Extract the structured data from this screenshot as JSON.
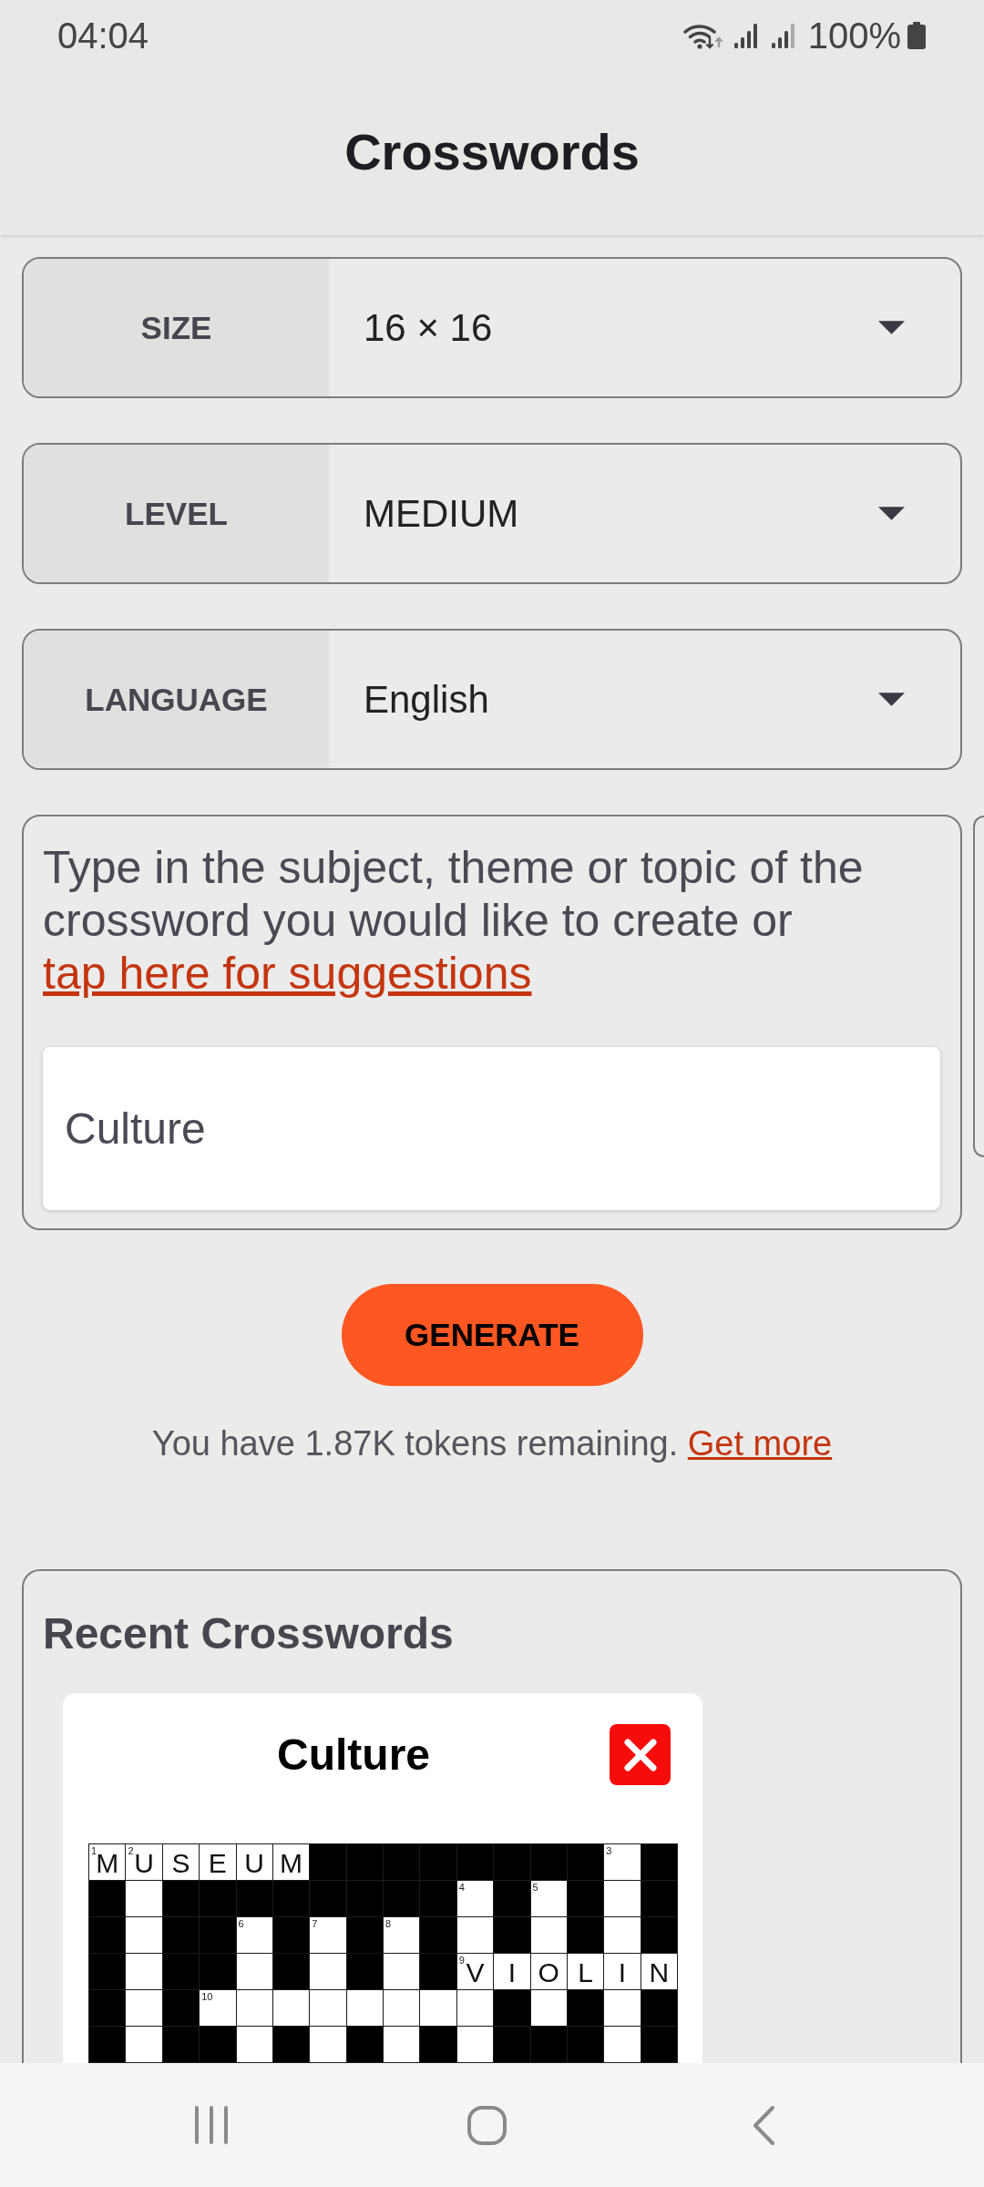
{
  "status_bar": {
    "time": "04:04",
    "battery": "100%"
  },
  "app_bar": {
    "title": "Crosswords"
  },
  "selects": [
    {
      "label": "SIZE",
      "value": "16 × 16"
    },
    {
      "label": "LEVEL",
      "value": "MEDIUM"
    },
    {
      "label": "LANGUAGE",
      "value": "English"
    }
  ],
  "topic_panel": {
    "instructions": "Type in the subject, theme or topic of the crossword you would like to create or ",
    "link": "tap here for suggestions"
  },
  "topic_field": {
    "value": "Culture"
  },
  "generate_button": {
    "label": "GENERATE"
  },
  "tokens": {
    "text": "You have 1.87K tokens remaining. ",
    "link": "Get more"
  },
  "recent": {
    "title": "Recent Crosswords",
    "crosswords": [
      {
        "title": "Culture",
        "grid": [
          [
            {
              "kind": "open",
              "number": "1",
              "letter": "M"
            },
            {
              "kind": "open",
              "number": "2",
              "letter": "U"
            },
            {
              "kind": "open",
              "letter": "S"
            },
            {
              "kind": "open",
              "letter": "E"
            },
            {
              "kind": "open",
              "letter": "U"
            },
            {
              "kind": "open",
              "letter": "M"
            },
            {
              "kind": "block"
            },
            {
              "kind": "block"
            },
            {
              "kind": "block"
            },
            {
              "kind": "block"
            },
            {
              "kind": "block"
            },
            {
              "kind": "block"
            },
            {
              "kind": "block"
            },
            {
              "kind": "block"
            },
            {
              "kind": "open",
              "number": "3"
            },
            {
              "kind": "block"
            }
          ],
          [
            {
              "kind": "block"
            },
            {
              "kind": "open"
            },
            {
              "kind": "block"
            },
            {
              "kind": "block"
            },
            {
              "kind": "block"
            },
            {
              "kind": "block"
            },
            {
              "kind": "block"
            },
            {
              "kind": "block"
            },
            {
              "kind": "block"
            },
            {
              "kind": "block"
            },
            {
              "kind": "open",
              "number": "4"
            },
            {
              "kind": "block"
            },
            {
              "kind": "open",
              "number": "5"
            },
            {
              "kind": "block"
            },
            {
              "kind": "open"
            },
            {
              "kind": "block"
            }
          ],
          [
            {
              "kind": "block"
            },
            {
              "kind": "open"
            },
            {
              "kind": "block"
            },
            {
              "kind": "block"
            },
            {
              "kind": "open",
              "number": "6"
            },
            {
              "kind": "block"
            },
            {
              "kind": "open",
              "number": "7"
            },
            {
              "kind": "block"
            },
            {
              "kind": "open",
              "number": "8"
            },
            {
              "kind": "block"
            },
            {
              "kind": "open"
            },
            {
              "kind": "block"
            },
            {
              "kind": "open"
            },
            {
              "kind": "block"
            },
            {
              "kind": "open"
            },
            {
              "kind": "block"
            }
          ],
          [
            {
              "kind": "block"
            },
            {
              "kind": "open"
            },
            {
              "kind": "block"
            },
            {
              "kind": "block"
            },
            {
              "kind": "open"
            },
            {
              "kind": "block"
            },
            {
              "kind": "open"
            },
            {
              "kind": "block"
            },
            {
              "kind": "open"
            },
            {
              "kind": "block"
            },
            {
              "kind": "open",
              "number": "9",
              "letter": "V"
            },
            {
              "kind": "open",
              "letter": "I"
            },
            {
              "kind": "open",
              "letter": "O"
            },
            {
              "kind": "open",
              "letter": "L"
            },
            {
              "kind": "open",
              "letter": "I"
            },
            {
              "kind": "open",
              "letter": "N"
            }
          ],
          [
            {
              "kind": "block"
            },
            {
              "kind": "open"
            },
            {
              "kind": "block"
            },
            {
              "kind": "open",
              "number": "10"
            },
            {
              "kind": "open"
            },
            {
              "kind": "open"
            },
            {
              "kind": "open"
            },
            {
              "kind": "open"
            },
            {
              "kind": "open"
            },
            {
              "kind": "open"
            },
            {
              "kind": "open"
            },
            {
              "kind": "block"
            },
            {
              "kind": "open"
            },
            {
              "kind": "block"
            },
            {
              "kind": "open"
            },
            {
              "kind": "block"
            }
          ],
          [
            {
              "kind": "block"
            },
            {
              "kind": "open"
            },
            {
              "kind": "block"
            },
            {
              "kind": "block"
            },
            {
              "kind": "open"
            },
            {
              "kind": "block"
            },
            {
              "kind": "open"
            },
            {
              "kind": "block"
            },
            {
              "kind": "open"
            },
            {
              "kind": "block"
            },
            {
              "kind": "open"
            },
            {
              "kind": "block"
            },
            {
              "kind": "block"
            },
            {
              "kind": "block"
            },
            {
              "kind": "open"
            },
            {
              "kind": "block"
            }
          ]
        ]
      }
    ]
  }
}
